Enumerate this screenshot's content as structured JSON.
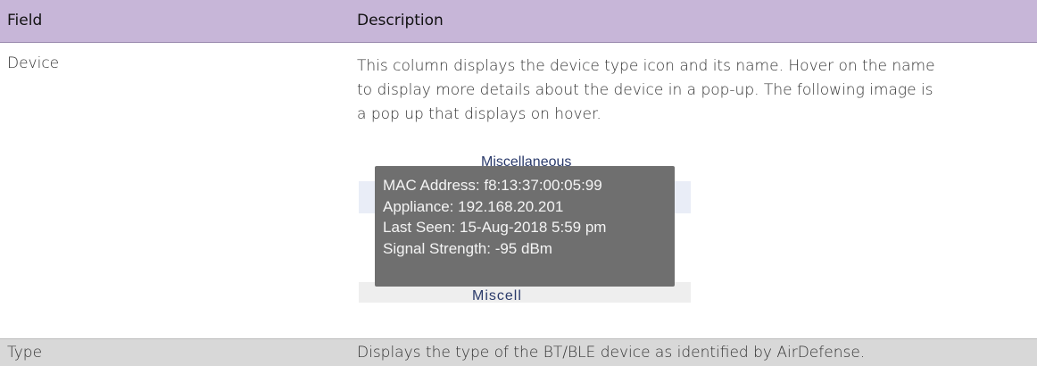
{
  "header": {
    "field": "Field",
    "description": "Description"
  },
  "rows": [
    {
      "field": "Device",
      "description": "This column displays the device type icon and its name. Hover on the name\nto display more details about the device in a pop-up. The following image is\na pop up that displays on hover."
    },
    {
      "field": "Type",
      "description": "Displays the type of the BT/BLE device as identified by AirDefense."
    }
  ],
  "popup_image": {
    "category_top": "Miscellaneous",
    "category_bottom": "Miscell",
    "tooltip_lines": [
      "MAC Address: f8:13:37:00:05:99",
      "Appliance: 192.168.20.201",
      "Last Seen: 15-Aug-2018 5:59 pm",
      "Signal Strength: -95 dBm"
    ]
  }
}
